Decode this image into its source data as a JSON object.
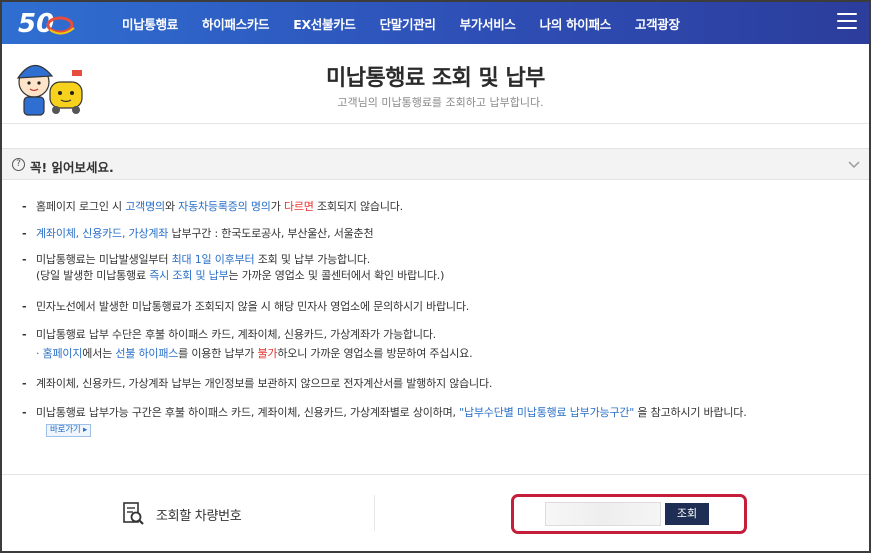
{
  "nav": {
    "logo_text": "50",
    "items": [
      "미납통행료",
      "하이패스카드",
      "EX선불카드",
      "단말기관리",
      "부가서비스",
      "나의 하이패스",
      "고객광장"
    ]
  },
  "header": {
    "title": "미납통행료 조회 및 납부",
    "subtitle": "고객님의 미납통행료를 조회하고 납부합니다."
  },
  "notice": {
    "icon_text": "?",
    "title": "꼭! 읽어보세요.",
    "items": {
      "n1": {
        "a": "홈페이지 로그인 시 ",
        "b": "고객명의",
        "c": "와 ",
        "d": "자동차등록증의 명의",
        "e": "가 ",
        "f": "다르면",
        "g": " 조회되지 않습니다."
      },
      "n2": {
        "a": "계좌이체, 신용카드, 가상계좌",
        "b": " 납부구간 : 한국도로공사, 부산울산, 서울춘천"
      },
      "n3": {
        "a": "미납통행료는 미납발생일부터 ",
        "b": "최대 1일 이후부터",
        "c": " 조회 및 납부 가능합니다.",
        "line2_a": "(당일 발생한 미납통행료 ",
        "line2_b": "즉시 조회 및 납부",
        "line2_c": "는 가까운 영업소 및 콜센터에서 확인 바랍니다.)"
      },
      "n4": {
        "a": "민자노선에서 발생한 미납통행료가 조회되지 않을 시 해당 민자사 영업소에 문의하시기 바랍니다."
      },
      "n5": {
        "a": "미납통행료 납부 수단은 후불 하이패스 카드, 계좌이체, 신용카드, 가상계좌가 가능합니다.",
        "sub_a": "홈페이지",
        "sub_b": "에서는 ",
        "sub_c": "선불 하이패스",
        "sub_d": "를 이용한 납부가 ",
        "sub_e": "불가",
        "sub_f": "하오니 가까운 영업소를 방문하여 주십시요."
      },
      "n6": {
        "a": "계좌이체, 신용카드, 가상계좌 납부는 개인정보를 보관하지 않으므로 전자계산서를 발행하지 않습니다."
      },
      "n7": {
        "a": "미납통행료 납부가능 구간은 후불 하이패스 카드, 계좌이체, 신용카드, 가상계좌별로 상이하며, ",
        "b": "\"납부수단별 미납통행료 납부가능구간\"",
        "c": " 을 참고하시기 바랍니다."
      },
      "go_button": "바로가기 ▸"
    }
  },
  "lookup": {
    "label": "조회할 차량번호",
    "input_value": "",
    "button": "조회"
  }
}
